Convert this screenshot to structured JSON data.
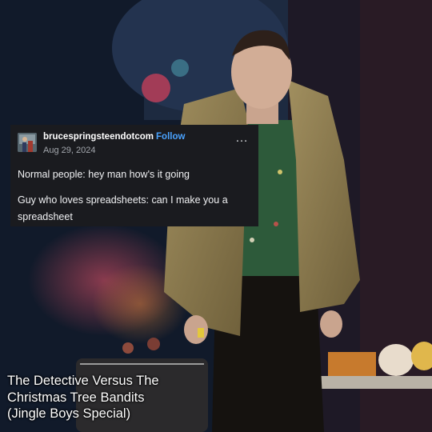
{
  "post": {
    "username": "brucespringsteendotcom",
    "follow_label": "Follow",
    "date": "Aug 29, 2024",
    "more_icon": "…",
    "line1": "Normal people: hey man how's it going",
    "line2": "Guy who loves spreadsheets: can I make you a spreadsheet"
  },
  "caption": {
    "lines": [
      "The Detective Versus The",
      "Christmas Tree Bandits",
      "(Jingle Boys Special)"
    ]
  },
  "colors": {
    "post_bg": "#1a1b1f",
    "follow": "#4aa3ff",
    "coat": "#8a7a4e",
    "shirt": "#2d5a3a"
  }
}
